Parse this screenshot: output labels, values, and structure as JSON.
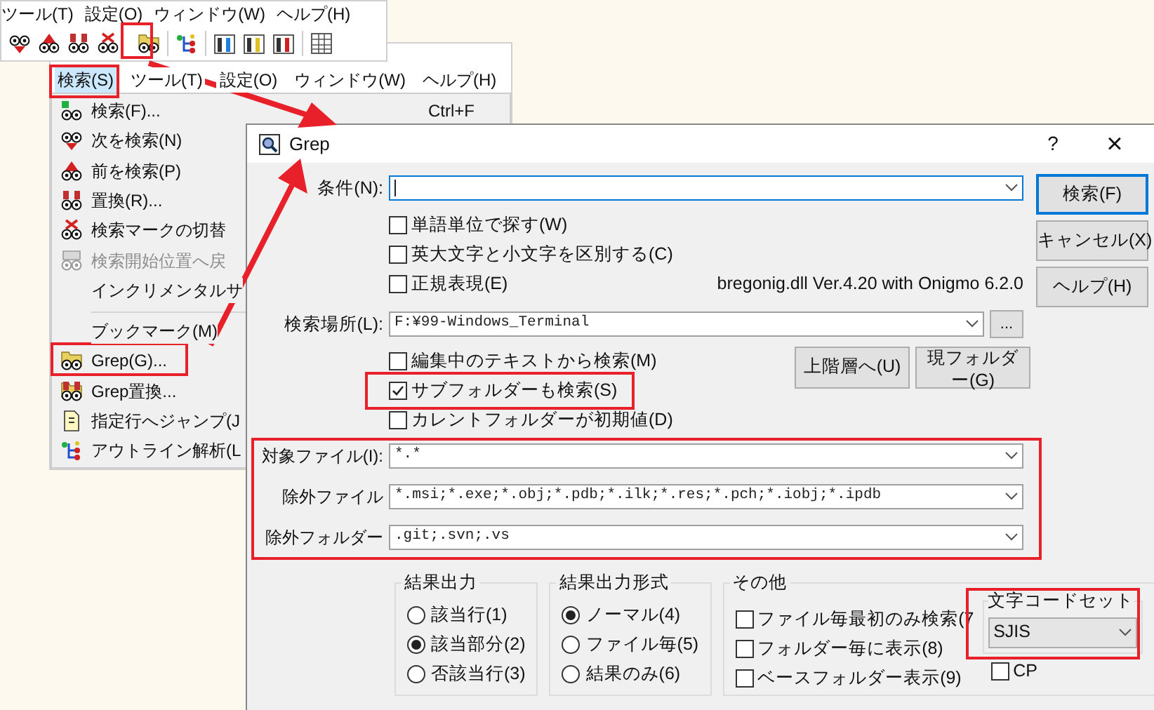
{
  "toolbar_window": {
    "menu": [
      {
        "label": "ツール(T)"
      },
      {
        "label": "設定(O)"
      },
      {
        "label": "ウィンドウ(W)"
      },
      {
        "label": "ヘルプ(H)"
      }
    ]
  },
  "editor_window": {
    "menu": [
      {
        "label": "検索(S)",
        "selected": true
      },
      {
        "label": "ツール(T)",
        "selected": false
      },
      {
        "label": "設定(O)",
        "selected": false
      },
      {
        "label": "ウィンドウ(W)",
        "selected": false
      },
      {
        "label": "ヘルプ(H)",
        "selected": false
      }
    ],
    "search_menu": [
      {
        "items": [
          {
            "label": "検索(F)...",
            "shortcut": "Ctrl+F",
            "disabled": false
          },
          {
            "label": "次を検索(N)",
            "disabled": false
          },
          {
            "label": "前を検索(P)",
            "disabled": false
          },
          {
            "label": "置換(R)...",
            "disabled": false
          },
          {
            "label": "検索マークの切替",
            "disabled": false
          },
          {
            "label": "検索開始位置へ戻",
            "disabled": true
          },
          {
            "label": "インクリメンタルサ",
            "disabled": false
          }
        ]
      },
      {
        "items": [
          {
            "label": "ブックマーク(M)",
            "disabled": false
          },
          {
            "label": "Grep(G)...",
            "disabled": false
          },
          {
            "label": "Grep置換...",
            "disabled": false
          },
          {
            "label": "指定行へジャンプ(J",
            "disabled": false
          },
          {
            "label": "アウトライン解析(L",
            "disabled": false
          }
        ]
      }
    ]
  },
  "dialog": {
    "title": "Grep",
    "help_button": "?",
    "close_button": "×",
    "condition": {
      "label": "条件(N):"
    },
    "options": [
      {
        "label": "単語単位で探す(W)",
        "checked": false
      },
      {
        "label": "英大文字と小文字を区別する(C)",
        "checked": false
      },
      {
        "label": "正規表現(E)",
        "checked": false
      }
    ],
    "engine_info": "bregonig.dll Ver.4.20 with Onigmo 6.2.0",
    "buttons": [
      "検索(F)",
      "キャンセル(X)",
      "ヘルプ(H)"
    ],
    "location": {
      "label": "検索場所(L):",
      "value": "F:¥99-Windows_Terminal",
      "browse": "..."
    },
    "location_options": [
      {
        "label": "編集中のテキストから検索(M)",
        "checked": false
      },
      {
        "label": "サブフォルダーも検索(S)",
        "checked": true
      },
      {
        "label": "カレントフォルダーが初期値(D)",
        "checked": false
      }
    ],
    "folder_buttons": [
      "上階層へ(U)",
      "現フォルダー(G)"
    ],
    "filters": [
      {
        "label": "対象ファイル(I):",
        "value": "*.*"
      },
      {
        "label": "除外ファイル",
        "value": "*.msi;*.exe;*.obj;*.pdb;*.ilk;*.res;*.pch;*.iobj;*.ipdb"
      },
      {
        "label": "除外フォルダー",
        "value": ".git;.svn;.vs"
      }
    ],
    "result_output": {
      "title": "結果出力",
      "options": [
        {
          "label": "該当行(1)",
          "selected": false
        },
        {
          "label": "該当部分(2)",
          "selected": true
        },
        {
          "label": "否該当行(3)",
          "selected": false
        }
      ]
    },
    "result_format": {
      "title": "結果出力形式",
      "options": [
        {
          "label": "ノーマル(4)",
          "selected": true
        },
        {
          "label": "ファイル毎(5)",
          "selected": false
        },
        {
          "label": "結果のみ(6)",
          "selected": false
        }
      ]
    },
    "other": {
      "title": "その他",
      "options": [
        {
          "label": "ファイル毎最初のみ検索(7",
          "checked": false
        },
        {
          "label": "フォルダー毎に表示(8)",
          "checked": false
        },
        {
          "label": "ベースフォルダー表示(9)",
          "checked": false
        }
      ],
      "charset": {
        "title": "文字コードセット",
        "value": "SJIS"
      },
      "cp": {
        "label": "CP",
        "checked": false
      }
    }
  }
}
